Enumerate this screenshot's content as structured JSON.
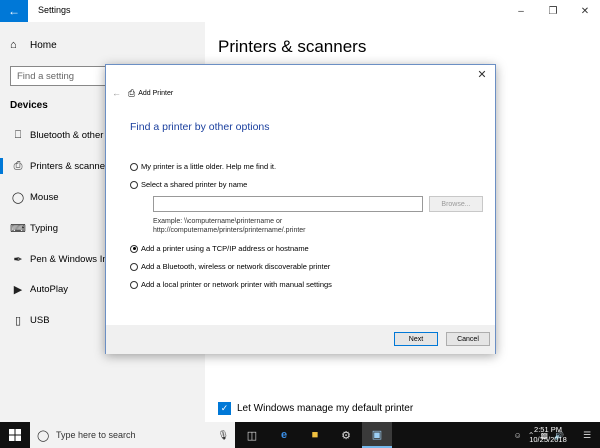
{
  "window": {
    "app_title": "Settings",
    "back_icon": "arrow-left-icon",
    "controls": [
      "minimize-icon",
      "maximize-icon",
      "close-icon"
    ]
  },
  "sidebar": {
    "home_label": "Home",
    "search_placeholder": "Find a setting",
    "section_heading": "Devices",
    "items": [
      {
        "label": "Bluetooth & other devices",
        "icon": "bluetooth-icon"
      },
      {
        "label": "Printers & scanners",
        "icon": "printer-icon",
        "selected": true
      },
      {
        "label": "Mouse",
        "icon": "mouse-icon"
      },
      {
        "label": "Typing",
        "icon": "keyboard-icon"
      },
      {
        "label": "Pen & Windows Ink",
        "icon": "pen-icon"
      },
      {
        "label": "AutoPlay",
        "icon": "autoplay-icon"
      },
      {
        "label": "USB",
        "icon": "usb-icon"
      }
    ]
  },
  "main": {
    "title": "Printers & scanners",
    "default_printer_checkbox": {
      "label": "Let Windows manage my default printer",
      "checked": true
    }
  },
  "dialog": {
    "window_title": "Add Printer",
    "heading": "Find a printer by other options",
    "options": [
      {
        "label": "My printer is a little older. Help me find it.",
        "checked": false
      },
      {
        "label": "Select a shared printer by name",
        "checked": false
      },
      {
        "label": "Add a printer using a TCP/IP address or hostname",
        "checked": true
      },
      {
        "label": "Add a Bluetooth, wireless or network discoverable printer",
        "checked": false
      },
      {
        "label": "Add a local printer or network printer with manual settings",
        "checked": false
      }
    ],
    "shared_name_value": "",
    "browse_label": "Browse...",
    "example_text": "Example: \\\\computername\\printername or\nhttp://computername/printers/printername/.printer",
    "next_label": "Next",
    "cancel_label": "Cancel"
  },
  "taskbar": {
    "search_placeholder": "Type here to search",
    "clock_time": "2:51 PM",
    "clock_date": "10/25/2018",
    "accent_color": "#0078d7"
  }
}
